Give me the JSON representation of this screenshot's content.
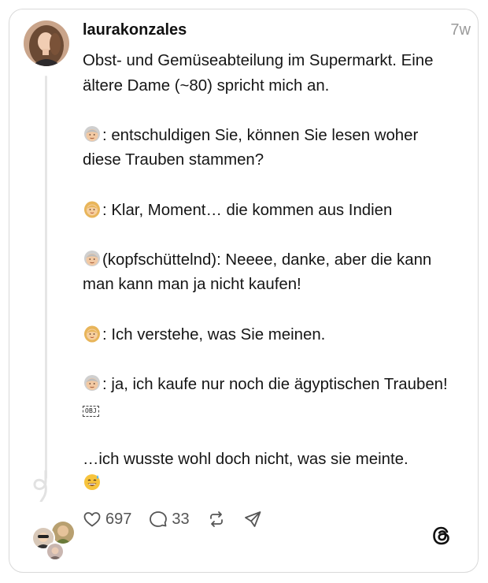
{
  "post": {
    "username": "laurakonzales",
    "timestamp": "7w",
    "lines": {
      "intro": "Obst- und Gemüseabteilung im Supermarkt. Eine ältere Dame (~80) spricht mich an.",
      "l1": ": entschuldigen Sie, können Sie lesen woher diese Trauben stammen?",
      "l2": ": Klar, Moment… die kommen aus Indien",
      "l3": "(kopfschüttelnd): Neeee, danke, aber die kann man kann man ja nicht kaufen!",
      "l4": ": Ich verstehe, was Sie meinen.",
      "l5": ": ja, ich kaufe nur noch die ägyptischen Trauben!",
      "l5_obj": "OBJ",
      "l6": "…ich wusste wohl doch nicht, was sie meinte."
    },
    "emoji": {
      "older_woman": "older-woman-emoji",
      "woman": "blond-woman-emoji",
      "sweat_smile": "grinning-sweat-emoji"
    }
  },
  "actions": {
    "likes": "697",
    "comments": "33",
    "repost_icon": "repost-icon",
    "share_icon": "send-icon"
  },
  "brand": {
    "logo": "threads-logo"
  },
  "colors": {
    "text": "#151515",
    "muted": "#9a9a9a",
    "border": "#d9d9d9",
    "thread_line": "#e6e6e6"
  }
}
